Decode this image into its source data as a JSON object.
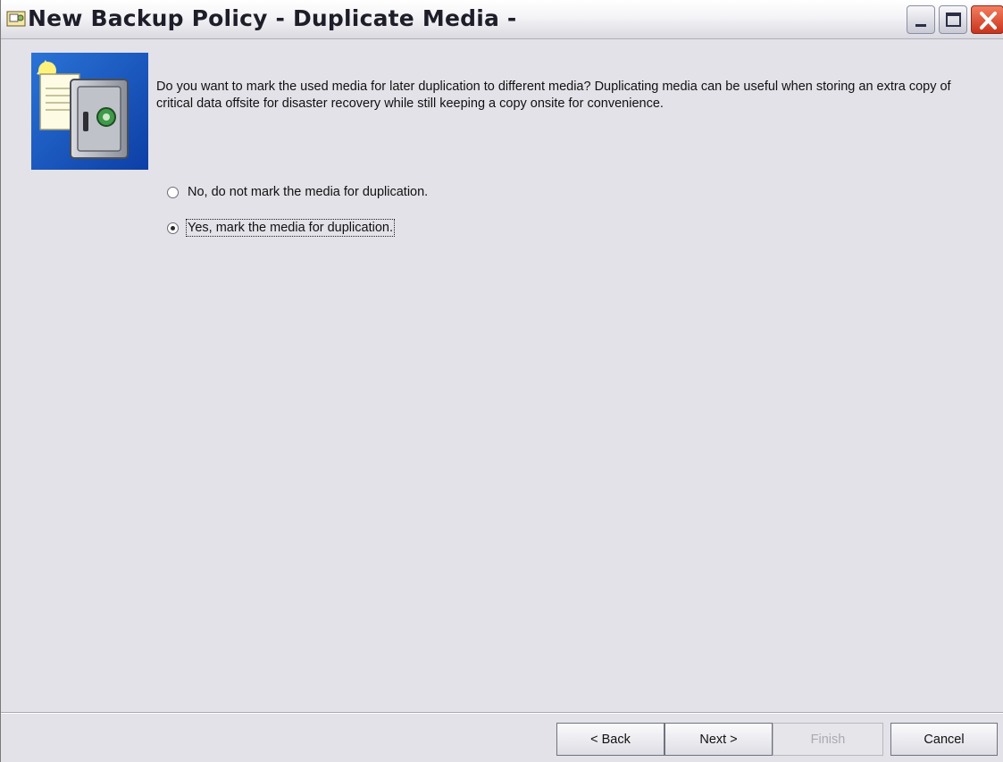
{
  "window": {
    "title": "New Backup Policy - Duplicate Media -",
    "controls": {
      "minimize": "minimize-icon",
      "maximize": "maximize-icon",
      "close": "close-icon"
    }
  },
  "content": {
    "hero_icon": "backup-safe-icon",
    "question": "Do you want to mark the used media for later duplication to different media? Duplicating media can be useful when storing an extra copy of critical data offsite for disaster recovery while still keeping a copy onsite for convenience.",
    "options": [
      {
        "label": "No, do not mark the media for duplication.",
        "selected": false
      },
      {
        "label": "Yes, mark the media for duplication.",
        "selected": true
      }
    ]
  },
  "buttons": {
    "back": "< Back",
    "next": "Next >",
    "finish": "Finish",
    "cancel": "Cancel"
  },
  "colors": {
    "background": "#e3e2e8",
    "close_button": "#c8331c",
    "disabled_text": "#a9a9b0"
  }
}
